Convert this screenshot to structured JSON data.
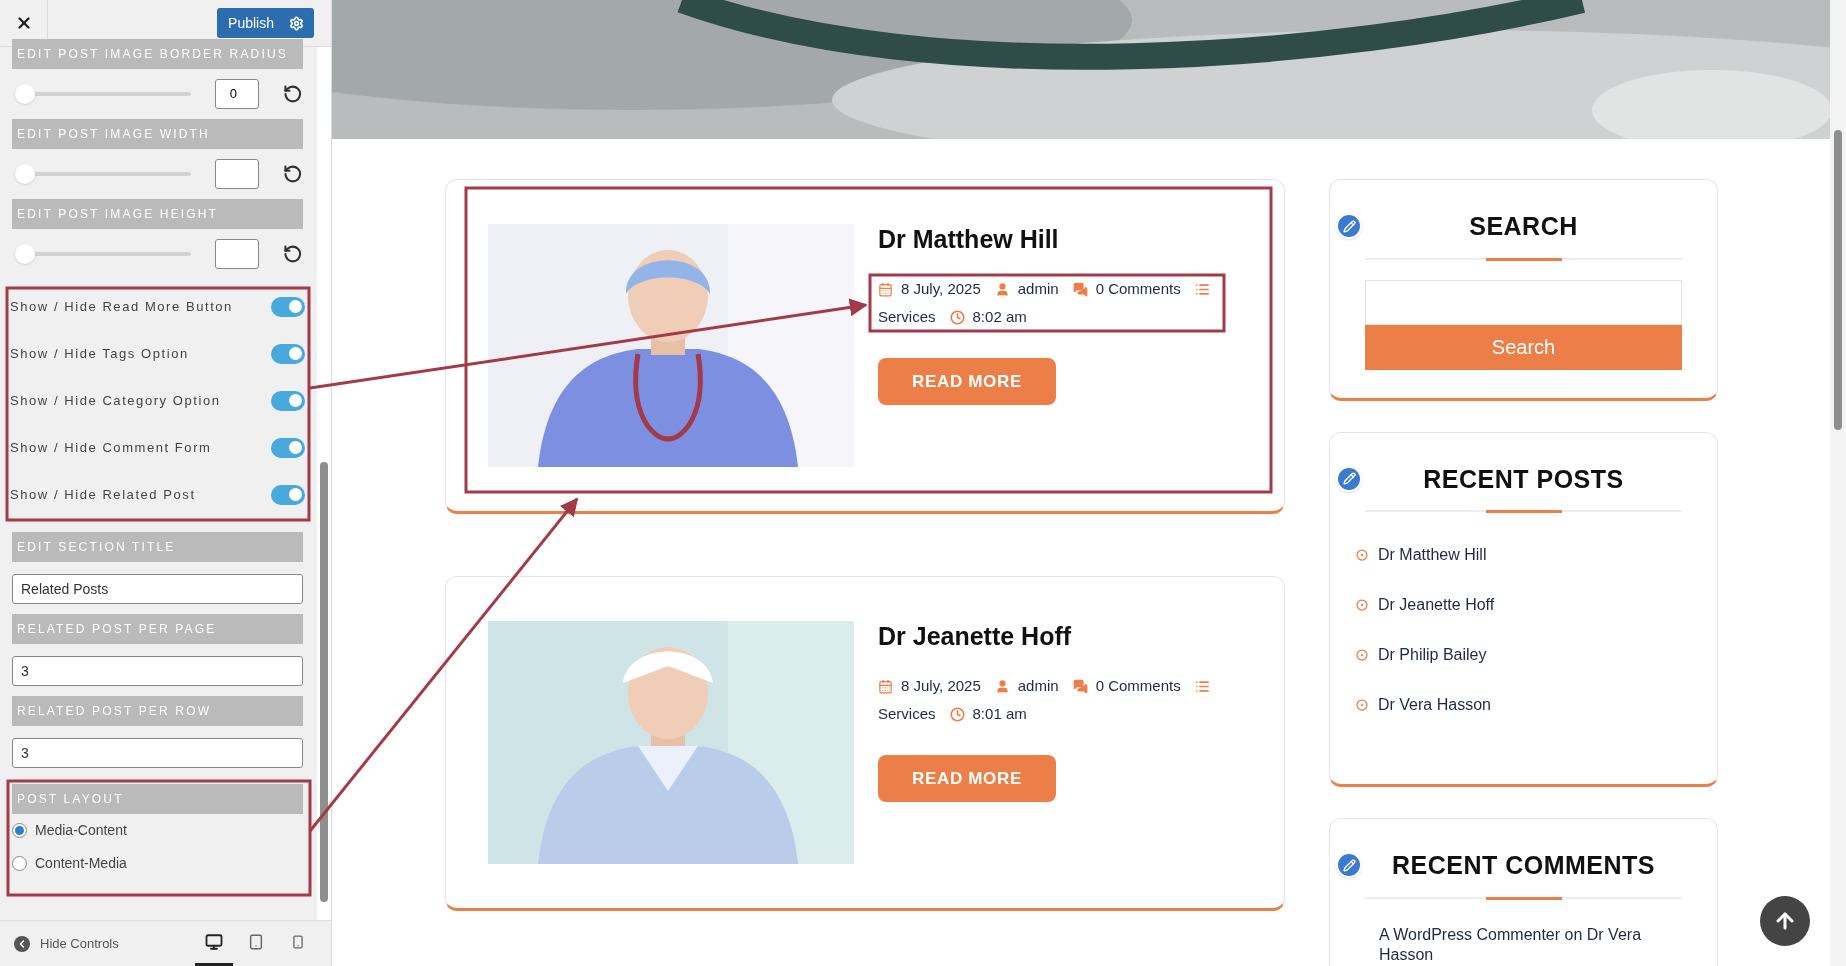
{
  "customizer": {
    "publish_button": "Publish",
    "sections": [
      {
        "kind": "slider",
        "title": "EDIT POST IMAGE BORDER RADIUS",
        "level": 0,
        "value": "0"
      },
      {
        "kind": "slider",
        "title": "EDIT POST IMAGE WIDTH",
        "level": 0
      },
      {
        "kind": "slider",
        "title": "EDIT POST IMAGE HEIGHT",
        "level": 0
      },
      {
        "kind": "toggles",
        "items": [
          {
            "label": "Show / Hide Read More Button",
            "on": true
          },
          {
            "label": "Show / Hide Tags Option",
            "on": true
          },
          {
            "label": "Show / Hide Category Option",
            "on": true
          },
          {
            "label": "Show / Hide Comment Form",
            "on": true
          },
          {
            "label": "Show / Hide Related Post",
            "on": true
          }
        ]
      },
      {
        "kind": "text",
        "title": "EDIT SECTION TITLE",
        "value": "Related Posts"
      },
      {
        "kind": "text",
        "title": "RELATED POST PER PAGE",
        "value": "3"
      },
      {
        "kind": "text",
        "title": "RELATED POST PER ROW",
        "value": "3"
      },
      {
        "kind": "radio",
        "title": "POST LAYOUT",
        "options": [
          {
            "label": "Media-Content",
            "selected": true
          },
          {
            "label": "Content-Media",
            "selected": false
          }
        ]
      }
    ],
    "hide_controls": "Hide Controls",
    "devices": [
      {
        "kind": "desktop",
        "selected": true
      },
      {
        "kind": "tablet",
        "selected": false
      },
      {
        "kind": "mobile",
        "selected": false
      }
    ]
  },
  "posts": [
    {
      "title": "Dr Matthew Hill",
      "date": "8 July, 2025",
      "author": "admin",
      "comments": "0 Comments",
      "category": "Services",
      "time": "8:02 am",
      "button": "READ MORE"
    },
    {
      "title": "Dr Jeanette Hoff",
      "date": "8 July, 2025",
      "author": "admin",
      "comments": "0 Comments",
      "category": "Services",
      "time": "8:01 am",
      "button": "READ MORE"
    }
  ],
  "widgets": [
    {
      "kind": "search",
      "title": "SEARCH",
      "button": "Search"
    },
    {
      "kind": "list",
      "title": "RECENT POSTS",
      "items": [
        "Dr Matthew Hill",
        "Dr Jeanette Hoff",
        "Dr Philip Bailey",
        "Dr Vera Hasson"
      ]
    },
    {
      "kind": "comments",
      "title": "RECENT COMMENTS",
      "items": [
        "A WordPress Commenter on Dr Vera Hasson"
      ]
    }
  ]
}
